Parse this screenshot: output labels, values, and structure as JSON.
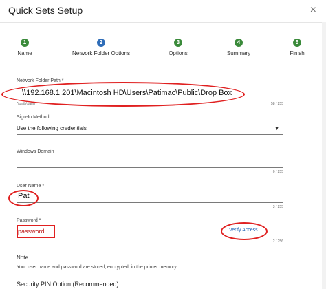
{
  "header": {
    "title": "Quick Sets Setup",
    "close_glyph": "×"
  },
  "steps": [
    {
      "number": "1",
      "label": "Name",
      "state": "done"
    },
    {
      "number": "2",
      "label": "Network Folder Options",
      "state": "active"
    },
    {
      "number": "3",
      "label": "Options",
      "state": "todo"
    },
    {
      "number": "4",
      "label": "Summary",
      "state": "todo"
    },
    {
      "number": "5",
      "label": "Finish",
      "state": "todo"
    }
  ],
  "colors": {
    "done": "#3a8a3a",
    "active": "#2f6db8",
    "todo": "#3a8a3a",
    "annotation": "#e02020"
  },
  "form": {
    "folder_path": {
      "label": "Network Folder Path *",
      "value": "\\\\192.168.1.201\\Macintosh HD\\Users\\Patimac\\Public\\Drop Box",
      "helper": "(\\\\path\\path)",
      "counter": "58 / 255"
    },
    "signin": {
      "label": "Sign-In Method",
      "value": "Use the following credentials"
    },
    "domain": {
      "label": "Windows Domain",
      "value": "",
      "counter": "0 / 255"
    },
    "username": {
      "label": "User Name *",
      "value": "Pat",
      "counter": "3 / 255"
    },
    "password": {
      "label": "Password *",
      "value": "password",
      "counter": "2 / 256"
    },
    "verify_label": "Verify Access"
  },
  "note": {
    "heading": "Note",
    "body": "Your user name and password are stored, encrypted, in the printer memory."
  },
  "pin": {
    "heading": "Security PIN Option (Recommended)"
  }
}
